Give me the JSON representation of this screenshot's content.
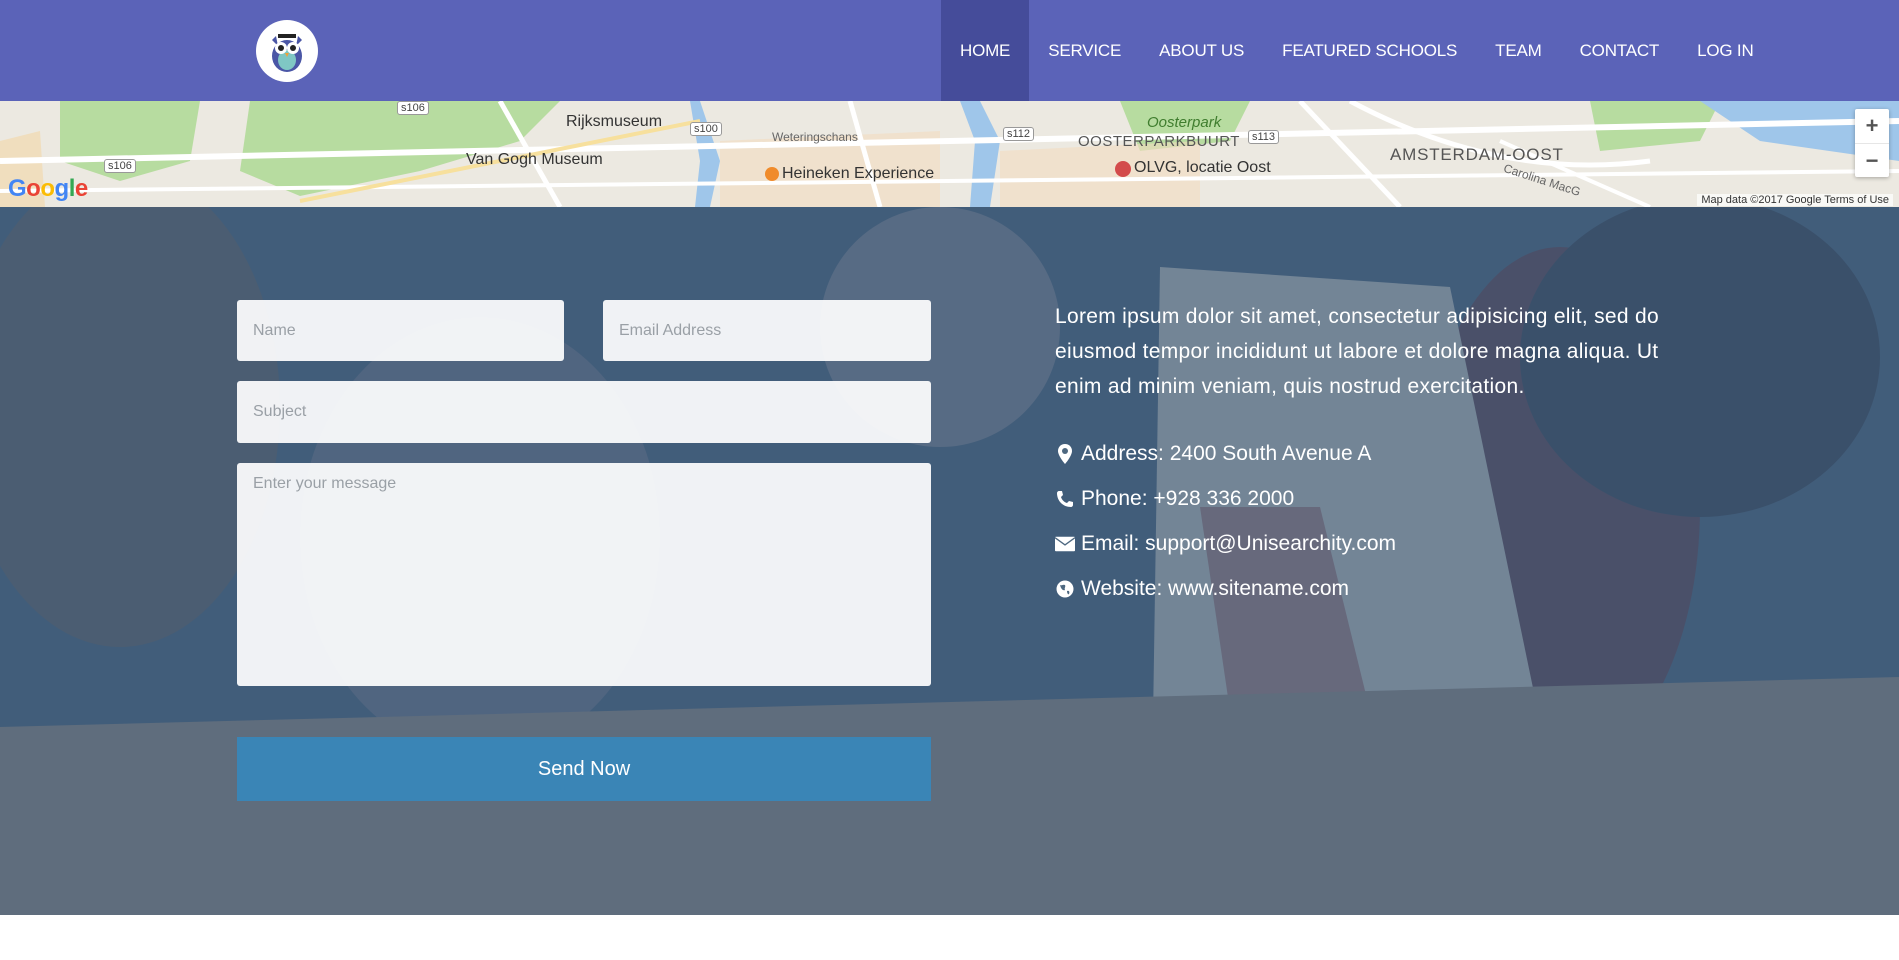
{
  "nav": {
    "items": [
      {
        "label": "HOME",
        "active": true
      },
      {
        "label": "SERVICE",
        "active": false
      },
      {
        "label": "ABOUT US",
        "active": false
      },
      {
        "label": "FEATURED SCHOOLS",
        "active": false
      },
      {
        "label": "TEAM",
        "active": false
      },
      {
        "label": "CONTACT",
        "active": false
      },
      {
        "label": "LOG IN",
        "active": false
      }
    ]
  },
  "map": {
    "labels": {
      "rijksmuseum": "Rijksmuseum",
      "van_gogh": "Van Gogh Museum",
      "heineken": "Heineken Experience",
      "oosterpark": "Oosterpark",
      "oosterparkbuurt": "OOSTERPARKBUURT",
      "olvg": "OLVG, locatie Oost",
      "amsterdam_oost": "AMSTERDAM-OOST",
      "weteringschans": "Weteringschans",
      "carolina": "Carolina MacG",
      "s106a": "s106",
      "s106b": "s106",
      "s100": "s100",
      "s112": "s112",
      "s113": "s113"
    },
    "attribution": "Map data ©2017 Google   Terms of Use",
    "google": "Google",
    "zoom_in": "+",
    "zoom_out": "−"
  },
  "form": {
    "name_placeholder": "Name",
    "email_placeholder": "Email Address",
    "subject_placeholder": "Subject",
    "message_placeholder": "Enter your message",
    "send_label": "Send Now"
  },
  "info": {
    "description": "Lorem ipsum dolor sit amet, consectetur adipisicing elit, sed do eiusmod tempor incididunt ut labore et dolore magna aliqua. Ut enim ad minim veniam, quis nostrud exercitation.",
    "address": "Address: 2400 South Avenue A",
    "phone": "Phone: +928 336 2000",
    "email": "Email: support@Unisearchity.com",
    "website": "Website: www.sitename.com"
  },
  "icons": {
    "logo": "owl-logo-icon",
    "address": "map-marker-icon",
    "phone": "phone-icon",
    "email": "envelope-icon",
    "website": "globe-icon"
  },
  "colors": {
    "navbar": "#5b63b8",
    "nav_active": "#454c9a",
    "send_button": "#3a85b6"
  }
}
